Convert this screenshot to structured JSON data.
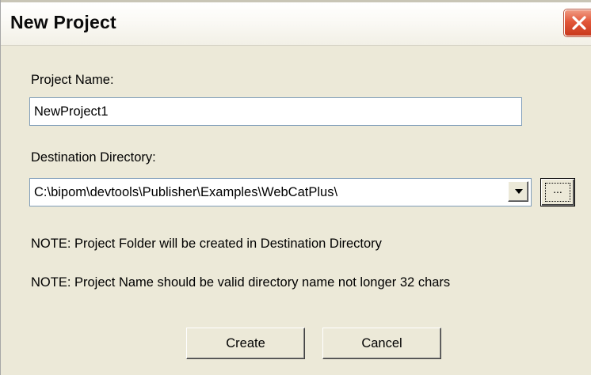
{
  "window": {
    "title": "New Project"
  },
  "form": {
    "project_name_label": "Project Name:",
    "project_name_value": "NewProject1",
    "destination_label": "Destination Directory:",
    "destination_value": "C:\\bipom\\devtools\\Publisher\\Examples\\WebCatPlus\\",
    "browse_label": "...",
    "note_1": "NOTE: Project Folder will be created in Destination Directory",
    "note_2": "NOTE: Project Name should be valid directory name not longer 32 chars"
  },
  "buttons": {
    "create_label": "Create",
    "cancel_label": "Cancel"
  },
  "icons": {
    "close": "close-icon",
    "dropdown": "chevron-down-icon"
  },
  "colors": {
    "dialog_background": "#ece9d8",
    "close_button": "#e2573a",
    "input_border": "#7f9db9"
  }
}
